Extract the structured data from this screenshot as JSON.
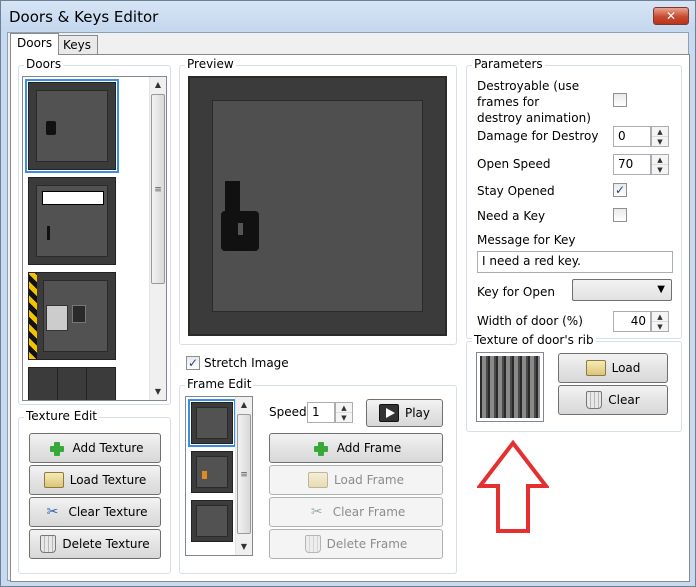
{
  "window": {
    "title": "Doors & Keys Editor",
    "close_label": "✕"
  },
  "tabs": [
    {
      "label": "Doors"
    },
    {
      "label": "Keys"
    }
  ],
  "doors_group": {
    "label": "Doors"
  },
  "texture_edit": {
    "label": "Texture Edit",
    "add": "Add Texture",
    "load": "Load Texture",
    "clear": "Clear Texture",
    "delete": "Delete Texture"
  },
  "preview": {
    "label": "Preview"
  },
  "stretch_image": {
    "label": "Stretch Image",
    "checked": true
  },
  "frame_edit": {
    "label": "Frame Edit",
    "speed_label": "Speed",
    "speed_value": "1",
    "play": "Play",
    "add": "Add Frame",
    "load": "Load Frame",
    "clear": "Clear Frame",
    "delete": "Delete Frame"
  },
  "parameters": {
    "label": "Parameters",
    "destroyable_label": "Destroyable (use frames for destroy animation)",
    "destroyable_line1": "Destroyable (use",
    "destroyable_line2": "frames for",
    "destroyable_line3": "destroy animation)",
    "destroyable_checked": false,
    "damage_label": "Damage for Destroy",
    "damage_value": "0",
    "open_speed_label": "Open Speed",
    "open_speed_value": "70",
    "stay_opened_label": "Stay Opened",
    "stay_opened_checked": true,
    "need_key_label": "Need a Key",
    "need_key_checked": false,
    "message_label": "Message for Key",
    "message_value": "I need a red key.",
    "key_for_open_label": "Key for Open",
    "key_for_open_value": "",
    "width_label": "Width of door (%)",
    "width_value": "40"
  },
  "rib_texture": {
    "label": "Texture of door's rib",
    "load": "Load",
    "clear": "Clear"
  },
  "icons": {
    "close": "close-icon",
    "plus": "plus-icon",
    "folder": "folder-icon",
    "scissors": "scissors-icon",
    "trash": "trash-icon",
    "play": "play-icon",
    "arrow": "up-arrow-annotation"
  },
  "colors": {
    "accent": "#3a8ee6",
    "annotation": "#e53030",
    "door": "#4a4a4a"
  }
}
